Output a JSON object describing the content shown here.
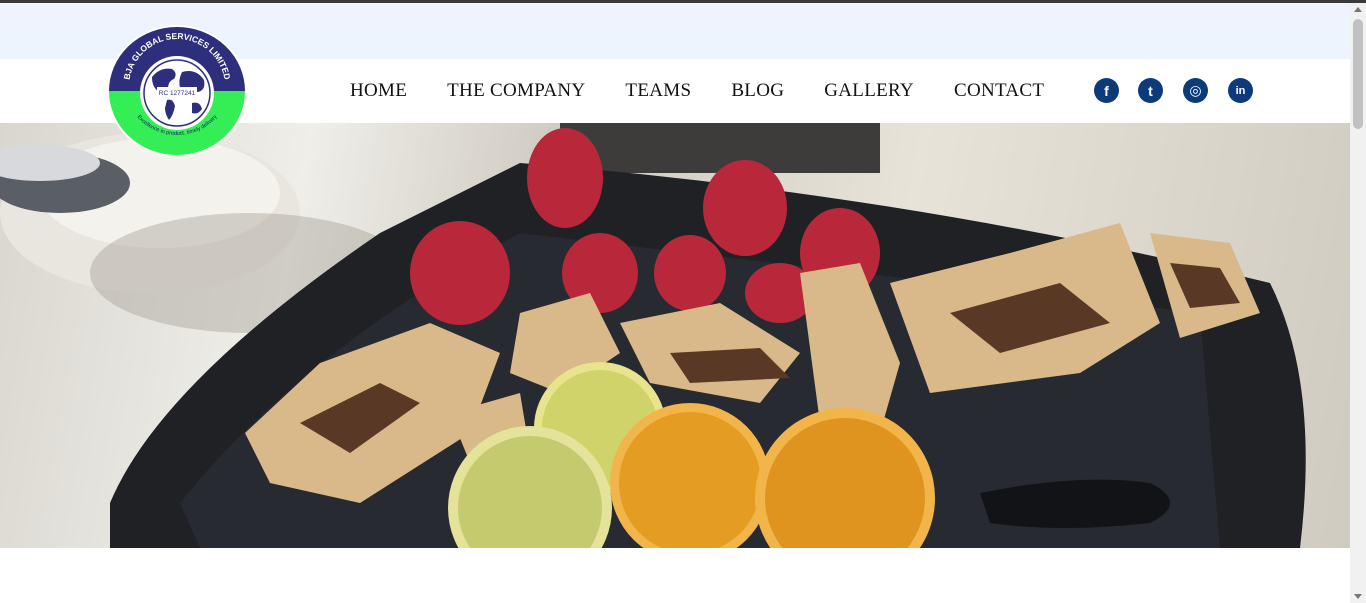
{
  "brand": {
    "name": "BJA GLOBAL SERVICES LIMITED",
    "rc": "RC 1277241",
    "tagline": "Excellence in product, timely delivery",
    "colors": {
      "navy": "#2d2f7c",
      "green": "#33ee55"
    }
  },
  "nav": {
    "items": [
      {
        "label": "HOME"
      },
      {
        "label": "THE COMPANY"
      },
      {
        "label": "TEAMS"
      },
      {
        "label": "BLOG"
      },
      {
        "label": "GALLERY"
      },
      {
        "label": "CONTACT"
      }
    ]
  },
  "social": [
    {
      "icon": "facebook-icon",
      "glyph": "f"
    },
    {
      "icon": "twitter-icon",
      "glyph": "t"
    },
    {
      "icon": "instagram-icon",
      "glyph": "◎"
    },
    {
      "icon": "linkedin-icon",
      "glyph": "in"
    }
  ],
  "hero": {
    "description_icon": "dessert-plate-image"
  }
}
